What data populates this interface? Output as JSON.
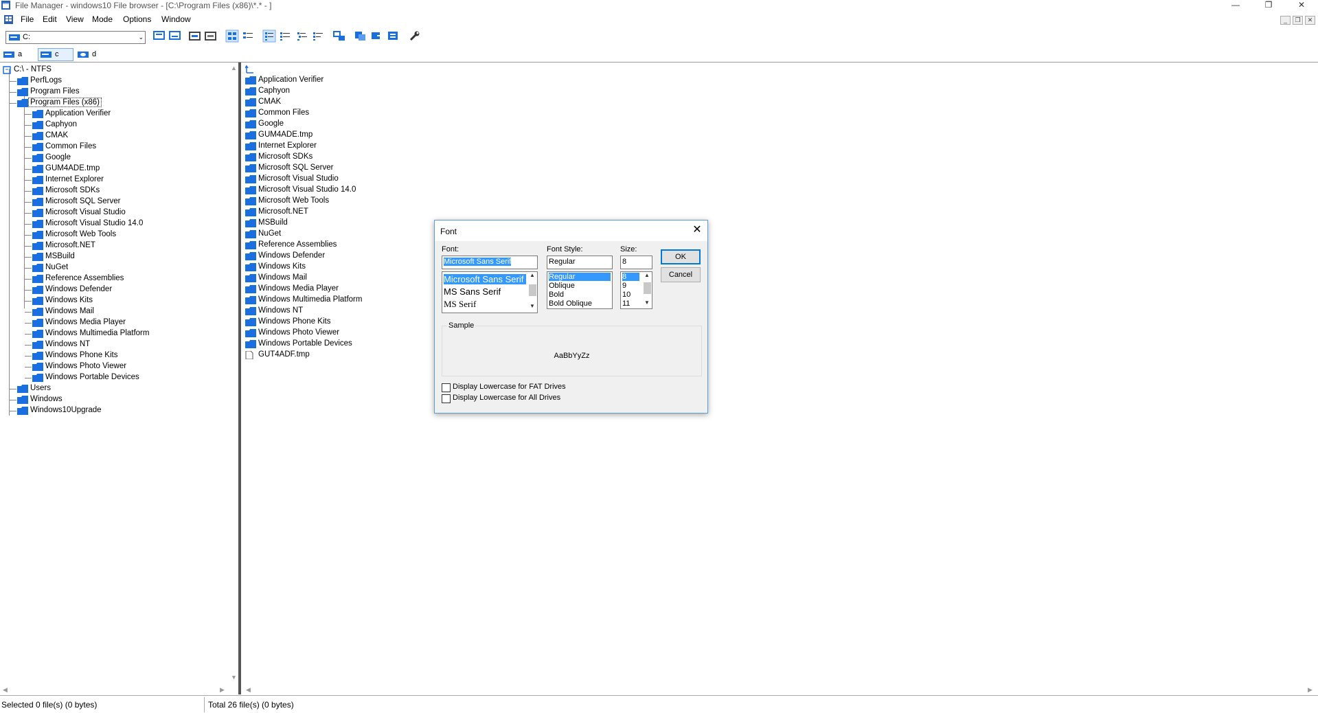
{
  "window": {
    "title": "File Manager - windows10 File browser - [C:\\Program Files (x86)\\*.* - ]",
    "minimize": "—",
    "restore": "❐",
    "close": "✕"
  },
  "menu": {
    "items": [
      "File",
      "Edit",
      "View",
      "Mode",
      "Options",
      "Window"
    ],
    "mdi_minimize": "_",
    "mdi_restore": "❐",
    "mdi_close": "✕"
  },
  "toolbar": {
    "drive_combo_value": "C:",
    "combo_arrow": "⌄"
  },
  "drives": [
    {
      "letter": "a"
    },
    {
      "letter": "c"
    },
    {
      "letter": "d"
    }
  ],
  "tree": {
    "root": "C:\\ - NTFS",
    "top_level": [
      "PerfLogs",
      "Program Files",
      "Program Files (x86)"
    ],
    "children": [
      "Application Verifier",
      "Caphyon",
      "CMAK",
      "Common Files",
      "Google",
      "GUM4ADE.tmp",
      "Internet Explorer",
      "Microsoft SDKs",
      "Microsoft SQL Server",
      "Microsoft Visual Studio",
      "Microsoft Visual Studio 14.0",
      "Microsoft Web Tools",
      "Microsoft.NET",
      "MSBuild",
      "NuGet",
      "Reference Assemblies",
      "Windows Defender",
      "Windows Kits",
      "Windows Mail",
      "Windows Media Player",
      "Windows Multimedia Platform",
      "Windows NT",
      "Windows Phone Kits",
      "Windows Photo Viewer",
      "Windows Portable Devices"
    ],
    "bottom_level": [
      "Users",
      "Windows",
      "Windows10Upgrade"
    ]
  },
  "file_list": {
    "up_entry": "..",
    "folders": [
      "Application Verifier",
      "Caphyon",
      "CMAK",
      "Common Files",
      "Google",
      "GUM4ADE.tmp",
      "Internet Explorer",
      "Microsoft SDKs",
      "Microsoft SQL Server",
      "Microsoft Visual Studio",
      "Microsoft Visual Studio 14.0",
      "Microsoft Web Tools",
      "Microsoft.NET",
      "MSBuild",
      "NuGet",
      "Reference Assemblies",
      "Windows Defender",
      "Windows Kits",
      "Windows Mail",
      "Windows Media Player",
      "Windows Multimedia Platform",
      "Windows NT",
      "Windows Phone Kits",
      "Windows Photo Viewer",
      "Windows Portable Devices"
    ],
    "files": [
      "GUT4ADF.tmp"
    ]
  },
  "status": {
    "selected": "Selected 0 file(s) (0 bytes)",
    "total": "Total 26 file(s) (0 bytes)"
  },
  "font_dialog": {
    "title": "Font",
    "close_glyph": "✕",
    "font_label": "Font:",
    "font_value": "Microsoft Sans Serif",
    "font_options": [
      "Microsoft Sans Serif",
      "MS Sans Serif",
      "MS Serif"
    ],
    "style_label": "Font Style:",
    "style_value": "Regular",
    "style_options": [
      "Regular",
      "Oblique",
      "Bold",
      "Bold Oblique"
    ],
    "size_label": "Size:",
    "size_value": "8",
    "size_options": [
      "8",
      "9",
      "10",
      "11"
    ],
    "ok": "OK",
    "cancel": "Cancel",
    "sample_label": "Sample",
    "sample_text": "AaBbYyZz",
    "chk_fat": "Display Lowercase for FAT Drives",
    "chk_all": "Display Lowercase for All Drives"
  },
  "colors": {
    "folder": "#1a6fe0",
    "selection": "#3399ff",
    "dialog_border": "#5d9cd8"
  }
}
